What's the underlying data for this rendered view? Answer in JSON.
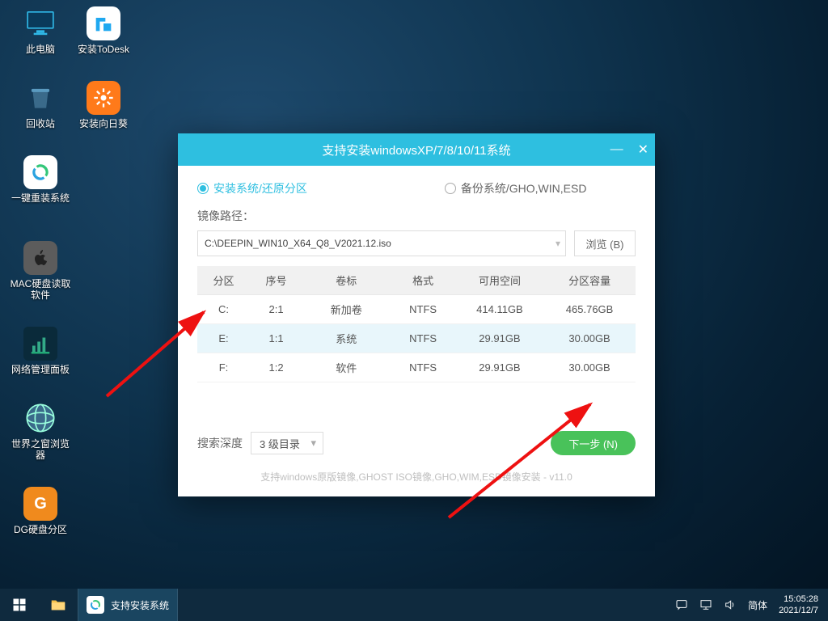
{
  "desktop_icons": [
    {
      "label": "此电脑"
    },
    {
      "label": "安装ToDesk"
    },
    {
      "label": "回收站"
    },
    {
      "label": "安装向日葵"
    },
    {
      "label": "一键重装系统"
    },
    {
      "label": "MAC硬盘读取软件"
    },
    {
      "label": "网络管理面板"
    },
    {
      "label": "世界之窗浏览器"
    },
    {
      "label": "DG硬盘分区"
    }
  ],
  "taskbar": {
    "task_label": "支持安装系统",
    "ime": "简体",
    "time": "15:05:28",
    "date": "2021/12/7"
  },
  "dialog": {
    "title": "支持安装windowsXP/7/8/10/11系统",
    "radio_install": "安装系统/还原分区",
    "radio_backup": "备份系统/GHO,WIN,ESD",
    "path_label": "镜像路径：",
    "path_value": "C:\\DEEPIN_WIN10_X64_Q8_V2021.12.iso",
    "browse": "浏览 (B)",
    "cols": {
      "part": "分区",
      "seq": "序号",
      "vol": "卷标",
      "fmt": "格式",
      "free": "可用空间",
      "cap": "分区容量"
    },
    "rows": [
      {
        "part": "C:",
        "seq": "2:1",
        "vol": "新加卷",
        "fmt": "NTFS",
        "free": "414.11GB",
        "cap": "465.76GB"
      },
      {
        "part": "E:",
        "seq": "1:1",
        "vol": "系统",
        "fmt": "NTFS",
        "free": "29.91GB",
        "cap": "30.00GB"
      },
      {
        "part": "F:",
        "seq": "1:2",
        "vol": "软件",
        "fmt": "NTFS",
        "free": "29.91GB",
        "cap": "30.00GB"
      }
    ],
    "depth_label": "搜索深度",
    "depth_value": "3 级目录",
    "next": "下一步 (N)",
    "note": "支持windows原版镜像,GHOST ISO镜像,GHO,WIM,ESD镜像安装 - v11.0"
  }
}
